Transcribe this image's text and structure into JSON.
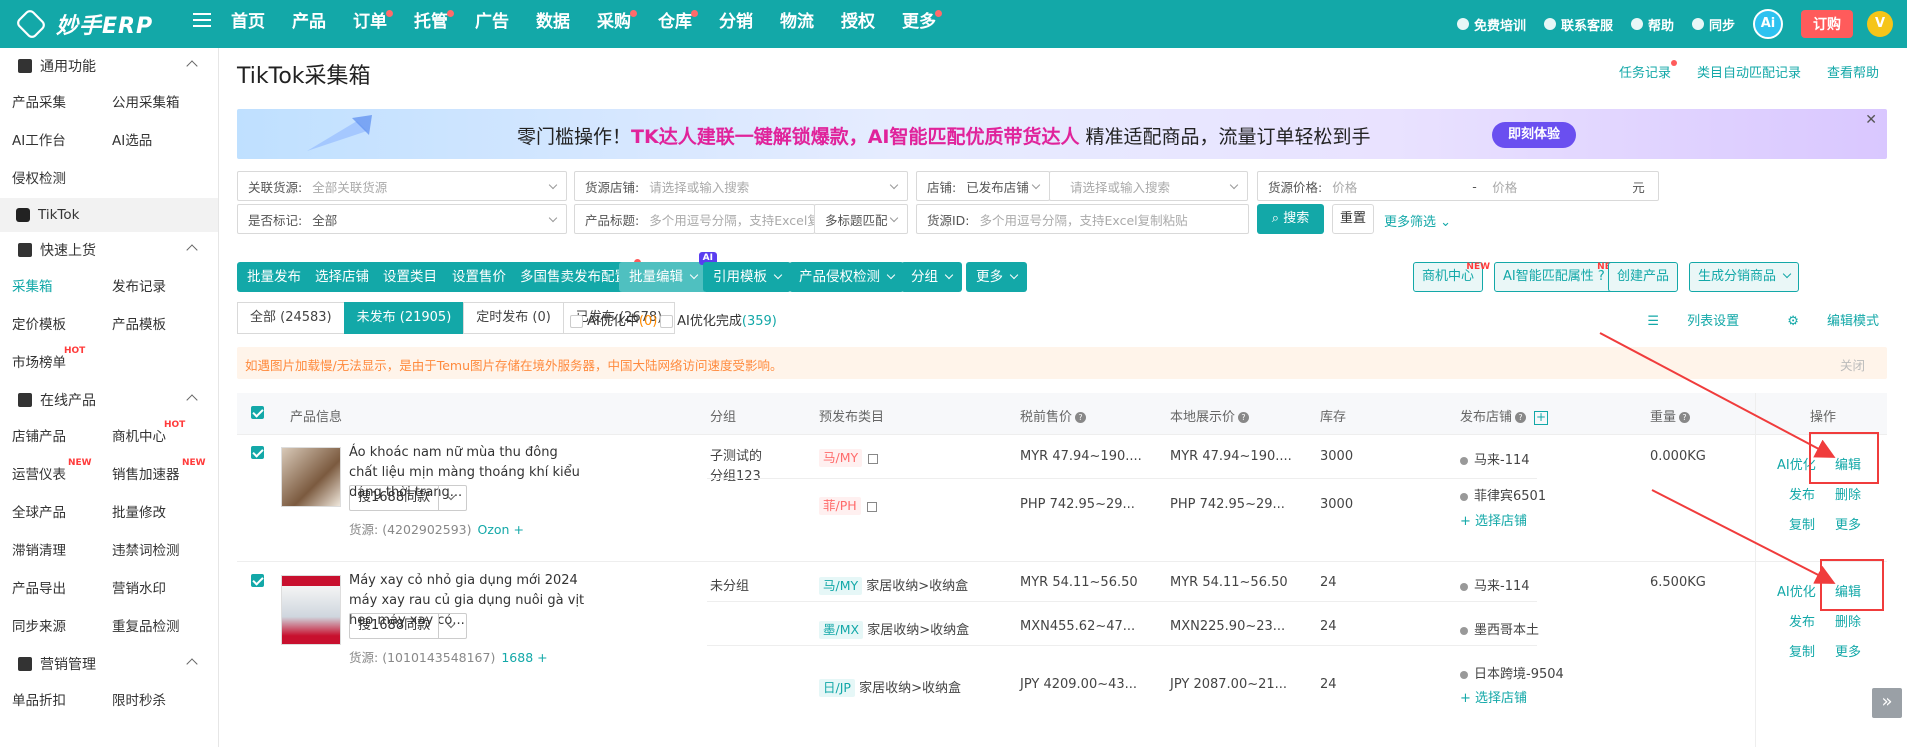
{
  "brand": {
    "logo_text": "妙手ERP"
  },
  "nav": {
    "items": [
      {
        "label": "首页",
        "dot": false
      },
      {
        "label": "产品",
        "dot": false
      },
      {
        "label": "订单",
        "dot": true
      },
      {
        "label": "托管",
        "dot": true
      },
      {
        "label": "广告",
        "dot": false
      },
      {
        "label": "数据",
        "dot": false
      },
      {
        "label": "采购",
        "dot": true
      },
      {
        "label": "仓库",
        "dot": true
      },
      {
        "label": "分销",
        "dot": false
      },
      {
        "label": "物流",
        "dot": false
      },
      {
        "label": "授权",
        "dot": false
      },
      {
        "label": "更多",
        "dot": true
      }
    ],
    "right": {
      "training": "免费培训",
      "contact": "联系客服",
      "help": "帮助",
      "sync": "同步",
      "ai": "Ai",
      "order": "订购",
      "user": "V"
    }
  },
  "sidebar": {
    "sections": [
      {
        "title": "通用功能",
        "items": [
          "产品采集",
          "公用采集箱",
          "AI工作台",
          "AI选品",
          "侵权检测"
        ]
      },
      {
        "title": "快速上货",
        "items": [
          "采集箱",
          "发布记录",
          "定价模板",
          "产品模板",
          "市场榜单"
        ]
      },
      {
        "title": "在线产品",
        "items": [
          "店铺产品",
          "商机中心",
          "运营仪表",
          "销售加速器",
          "全球产品",
          "批量修改",
          "滞销清理",
          "违禁词检测",
          "产品导出",
          "营销水印",
          "同步来源",
          "重复品检测"
        ]
      },
      {
        "title": "营销管理",
        "items": [
          "单品折扣",
          "限时秒杀"
        ]
      }
    ],
    "tiktok_label": "TikTok",
    "tags": {
      "hot": "HOT",
      "new": "NEW"
    }
  },
  "page": {
    "title": "TikTok采集箱",
    "links": {
      "task_record": "任务记录",
      "category_match": "类目自动匹配记录",
      "help": "查看帮助"
    }
  },
  "banner": {
    "prefix": "零门槛操作！",
    "highlight": "TK达人建联一键解锁爆款，AI智能匹配优质带货达人",
    "suffix": "精准适配商品，流量订单轻松到手",
    "button": "即刻体验",
    "close": "✕"
  },
  "filters": {
    "linked_source": {
      "label": "关联货源:",
      "placeholder": "全部关联货源"
    },
    "source_store": {
      "label": "货源店铺:",
      "placeholder": "请选择或输入搜索"
    },
    "store": {
      "label": "店铺:",
      "value": "已发布店铺",
      "placeholder": "请选择或输入搜索"
    },
    "source_price": {
      "label": "货源价格:",
      "min_placeholder": "价格",
      "dash": "-",
      "max_placeholder": "价格",
      "unit": "元"
    },
    "marked": {
      "label": "是否标记:",
      "value": "全部"
    },
    "title": {
      "label": "产品标题:",
      "placeholder": "多个用逗号分隔，支持Excel复制粘贴",
      "mode": "多标题匹配"
    },
    "source_id": {
      "label": "货源ID:",
      "placeholder": "多个用逗号分隔，支持Excel复制粘贴"
    },
    "search_button": "搜索",
    "reset_button": "重置",
    "more_filters": "更多筛选"
  },
  "actions": {
    "batch_publish": "批量发布",
    "select_store": "选择店铺",
    "set_category": "设置类目",
    "set_price": "设置售价",
    "multi_country": "多国售卖发布配置",
    "batch_edit": "批量编辑",
    "ai_tag": "AI",
    "use_template": "引用模板",
    "infringe_check": "产品侵权检测",
    "group": "分组",
    "more": "更多",
    "opportunity": "商机中心",
    "ai_match": "AI智能匹配属性",
    "create_product": "创建产品",
    "distribute": "生成分销商品",
    "new_tag": "NEW"
  },
  "tabs": [
    {
      "label": "全部 (24583)",
      "active": false
    },
    {
      "label": "未发布 (21905)",
      "active": true
    },
    {
      "label": "定时发布 (0)",
      "active": false
    },
    {
      "label": "已发布 (2678)",
      "active": false
    }
  ],
  "options": {
    "ai_optimizing": "AI优化中",
    "ai_optimizing_count": "(0)",
    "ai_done": "AI优化完成",
    "ai_done_count": "(359)",
    "list_settings": "列表设置",
    "edit_mode": "编辑模式"
  },
  "notice": {
    "text": "如遇图片加载慢/无法显示，是由于Temu图片存储在境外服务器，中国大陆网络访问速度受影响。",
    "close": "关闭"
  },
  "table": {
    "headers": {
      "product": "产品信息",
      "group": "分组",
      "category": "预发布类目",
      "pretax": "税前售价",
      "local": "本地展示价",
      "stock": "库存",
      "store": "发布店铺",
      "weight": "重量",
      "ops": "操作"
    },
    "rows": [
      {
        "title": "Áo khoác nam nữ mùa thu đông chất liệu mịn màng thoáng khí kiểu dáng thời trang...",
        "search_btn": "搜1688同款",
        "source_label": "货源:",
        "source_id": "(4202902593)",
        "platform": "Ozon",
        "group": "子测试的分组123",
        "group_line1": "子测试的",
        "group_line2": "分组123",
        "weight": "0.000KG",
        "subs": [
          {
            "market": "马/MY",
            "category": "",
            "pretax": "MYR 47.94~190....",
            "local": "MYR 47.94~190....",
            "stock": "3000",
            "store": "马来-114"
          },
          {
            "market": "菲/PH",
            "category": "",
            "pretax": "PHP 742.95~29...",
            "local": "PHP 742.95~29...",
            "stock": "3000",
            "store": "菲律宾6501"
          }
        ],
        "choose_store": "选择店铺"
      },
      {
        "title": "Máy xay cỏ nhỏ gia dụng mới 2024 máy xay rau củ gia dụng nuôi gà vịt heo máy xay cỏ...",
        "search_btn": "搜1688同款",
        "source_label": "货源:",
        "source_id": "(1010143548167)",
        "platform": "1688",
        "group": "未分组",
        "weight": "6.500KG",
        "subs": [
          {
            "market": "马/MY",
            "category": "家居收纳>收纳盒",
            "pretax": "MYR 54.11~56.50",
            "local": "MYR 54.11~56.50",
            "stock": "24",
            "store": "马来-114"
          },
          {
            "market": "墨/MX",
            "category": "家居收纳>收纳盒",
            "pretax": "MXN455.62~47...",
            "local": "MXN225.90~23...",
            "stock": "24",
            "store": "墨西哥本土"
          },
          {
            "market": "日/JP",
            "category": "家居收纳>收纳盒",
            "pretax": "JPY 4209.00~43...",
            "local": "JPY 2087.00~21...",
            "stock": "24",
            "store": "日本跨境-9504"
          }
        ],
        "choose_store": "选择店铺"
      }
    ],
    "ops": {
      "ai_opt": "AI优化",
      "edit": "编辑",
      "publish": "发布",
      "delete": "删除",
      "copy": "复制",
      "more": "更多"
    }
  },
  "colors": {
    "primary": "#13a8a8",
    "annotation": "#f03c3c",
    "highlight": "#e0239b",
    "warn": "#ff8a3d"
  }
}
